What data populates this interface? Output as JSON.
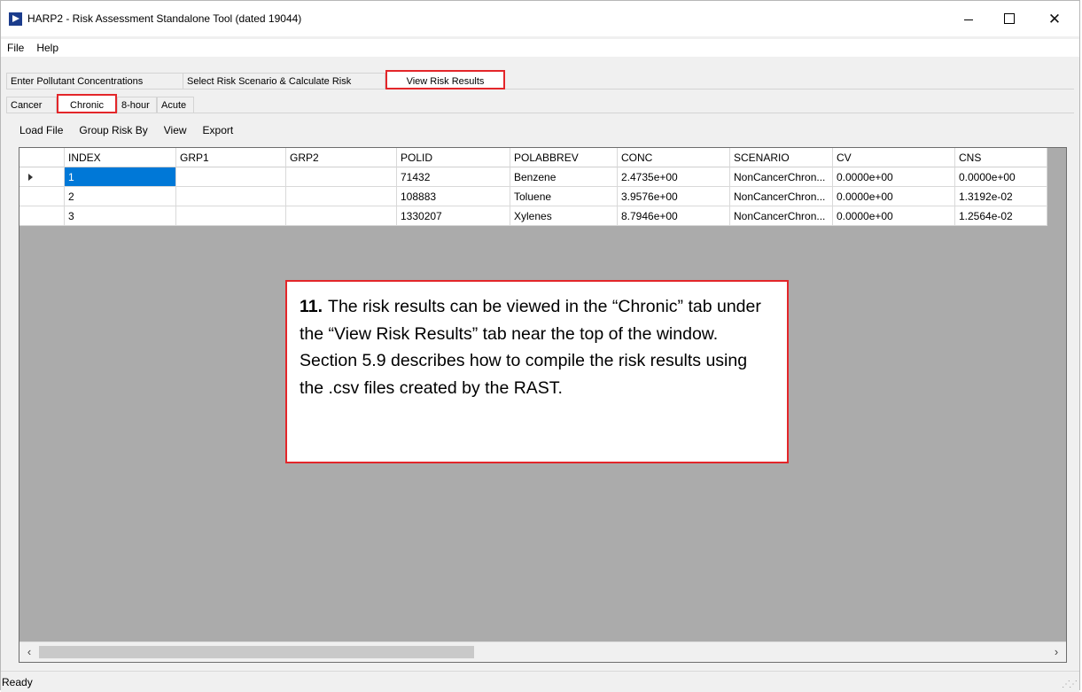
{
  "window": {
    "title": "HARP2 - Risk Assessment Standalone Tool (dated 19044)",
    "controls": {
      "minimize": "—",
      "maximize": "☐",
      "close": "✕"
    }
  },
  "menu": [
    "File",
    "Help"
  ],
  "main_tabs": [
    "Enter Pollutant Concentrations",
    "Select Risk Scenario & Calculate Risk",
    "View Risk Results"
  ],
  "active_main_tab": "View Risk Results",
  "sub_tabs": [
    "Cancer",
    "Chronic",
    "8-hour",
    "Acute"
  ],
  "active_sub_tab": "Chronic",
  "toolbar": [
    "Load File",
    "Group Risk By",
    "View",
    "Export"
  ],
  "grid": {
    "columns": [
      "INDEX",
      "GRP1",
      "GRP2",
      "POLID",
      "POLABBREV",
      "CONC",
      "SCENARIO",
      "CV",
      "CNS"
    ],
    "rows": [
      [
        "1",
        "",
        "",
        "71432",
        "Benzene",
        "2.4735e+00",
        "NonCancerChron...",
        "0.0000e+00",
        "0.0000e+00"
      ],
      [
        "2",
        "",
        "",
        "108883",
        "Toluene",
        "3.9576e+00",
        "NonCancerChron...",
        "0.0000e+00",
        "1.3192e-02"
      ],
      [
        "3",
        "",
        "",
        "1330207",
        "Xylenes",
        "8.7946e+00",
        "NonCancerChron...",
        "0.0000e+00",
        "1.2564e-02"
      ]
    ]
  },
  "callout": {
    "number": "11.",
    "text": "The risk results can be viewed in the “Chronic” tab under the “View Risk Results” tab near the top of the window. Section 5.9 describes how to compile the risk results using the .csv files created by the RAST."
  },
  "status": "Ready",
  "highlight_color": "#e3262a",
  "selection_color": "#0078d7"
}
